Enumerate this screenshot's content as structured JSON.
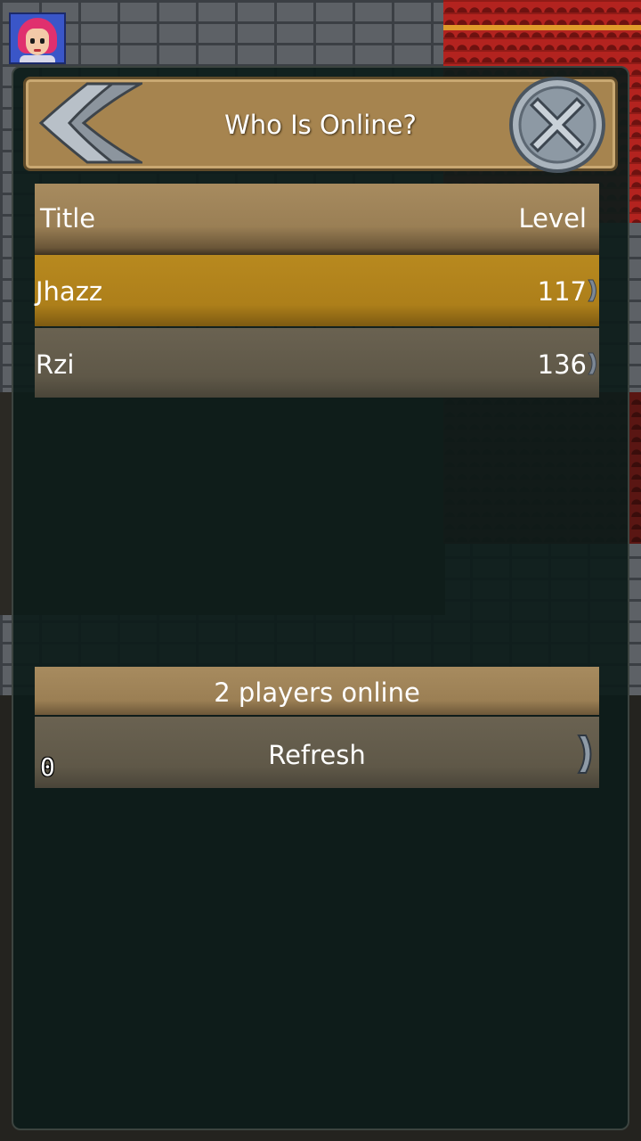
{
  "dialog": {
    "title": "Who Is Online?",
    "back_icon": "double-chevron-left-icon",
    "close_icon": "close-x-icon"
  },
  "table": {
    "columns": {
      "title": "Title",
      "level": "Level"
    },
    "rows": [
      {
        "name": "Jhazz",
        "level": "117",
        "selected": true
      },
      {
        "name": "Rzi",
        "level": "136",
        "selected": false
      }
    ]
  },
  "footer": {
    "count_text": "2 players online",
    "refresh_label": "Refresh",
    "refresh_counter": "0"
  },
  "colors": {
    "panel": "#0d1c1a",
    "header": "#a6844f",
    "selected_row": "#b8891f",
    "row": "#5f5848"
  }
}
